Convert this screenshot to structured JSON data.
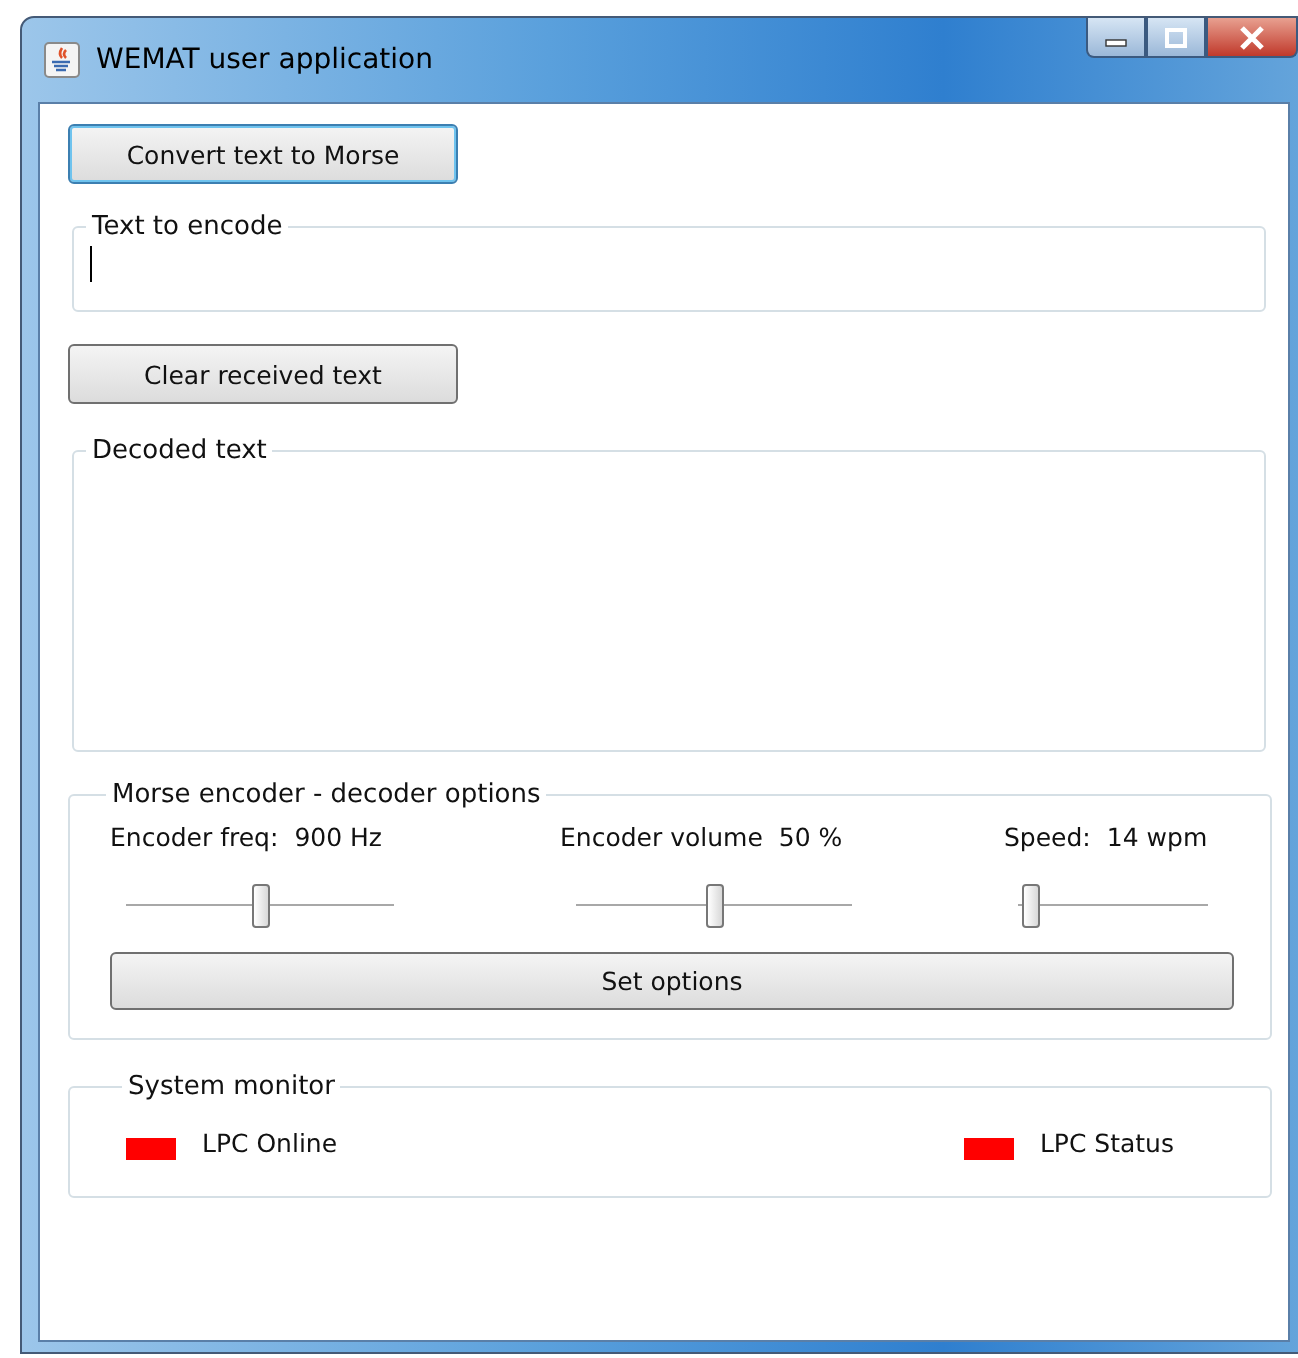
{
  "window": {
    "title": "WEMAT user application"
  },
  "convert_button": "Convert text to Morse",
  "text_to_encode": {
    "label": "Text to encode"
  },
  "clear_button": "Clear received text",
  "decoded": {
    "label": "Decoded text"
  },
  "options": {
    "label": "Morse encoder - decoder options",
    "sliders": [
      {
        "label": "Encoder freq:",
        "reading": "900 Hz",
        "level": 0.5
      },
      {
        "label": "Encoder volume",
        "reading": "50 %",
        "level": 0.5
      },
      {
        "label": "Speed:",
        "reading": "14 wpm",
        "level": 0.06
      }
    ],
    "set_button": "Set options"
  },
  "monitor": {
    "label": "System monitor",
    "indicators": [
      {
        "label": "LPC Online",
        "color": "#ff0000"
      },
      {
        "label": "LPC Status",
        "color": "#ff0000"
      }
    ]
  }
}
